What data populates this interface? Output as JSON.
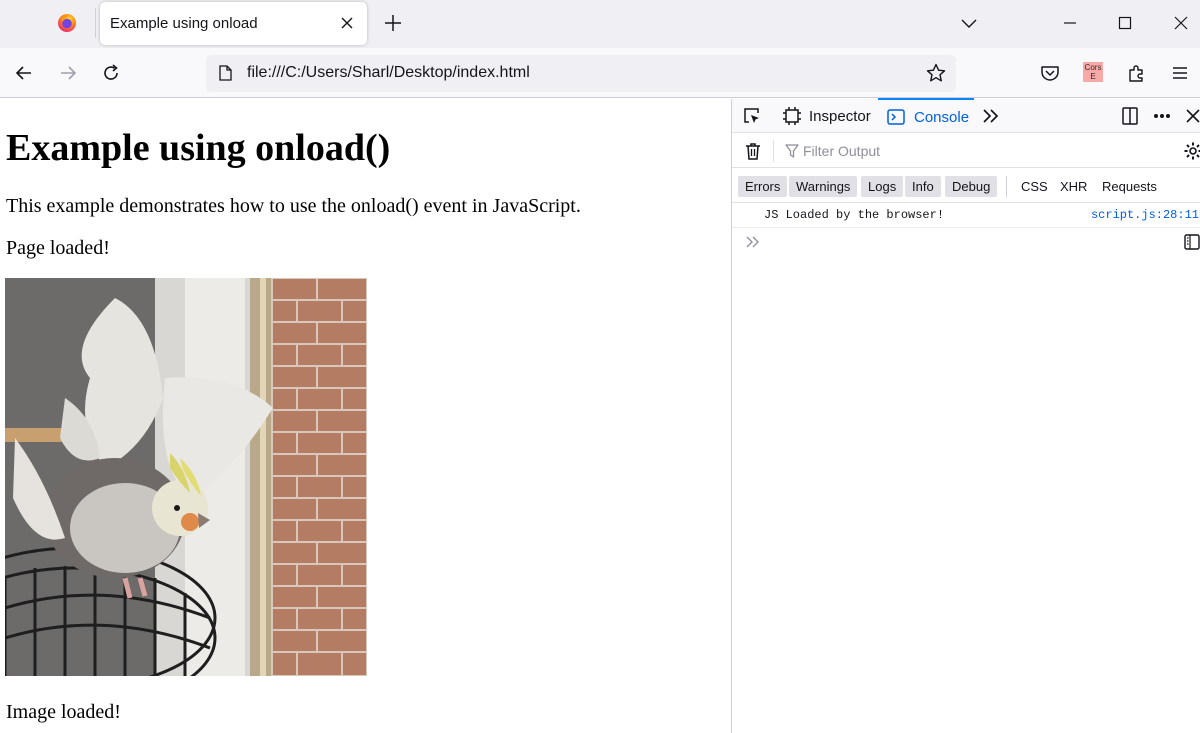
{
  "browser": {
    "tab_title": "Example using onload",
    "url": "file:///C:/Users/Sharl/Desktop/index.html",
    "cors_badge_text": "Cors E"
  },
  "page": {
    "heading": "Example using onload()",
    "description": "This example demonstrates how to use the onload() event in JavaScript.",
    "page_status": "Page loaded!",
    "image_status": "Image loaded!"
  },
  "devtools": {
    "tabs": [
      {
        "label": "Inspector"
      },
      {
        "label": "Console"
      }
    ],
    "filter_placeholder": "Filter Output",
    "levels": [
      "Errors",
      "Warnings",
      "Logs",
      "Info",
      "Debug"
    ],
    "request_filters": [
      "CSS",
      "XHR",
      "Requests"
    ],
    "log": {
      "message": "JS Loaded by the browser!",
      "source": "script.js:28:11"
    }
  },
  "colors": {
    "accent": "#0a84ff",
    "link": "#0060df"
  }
}
